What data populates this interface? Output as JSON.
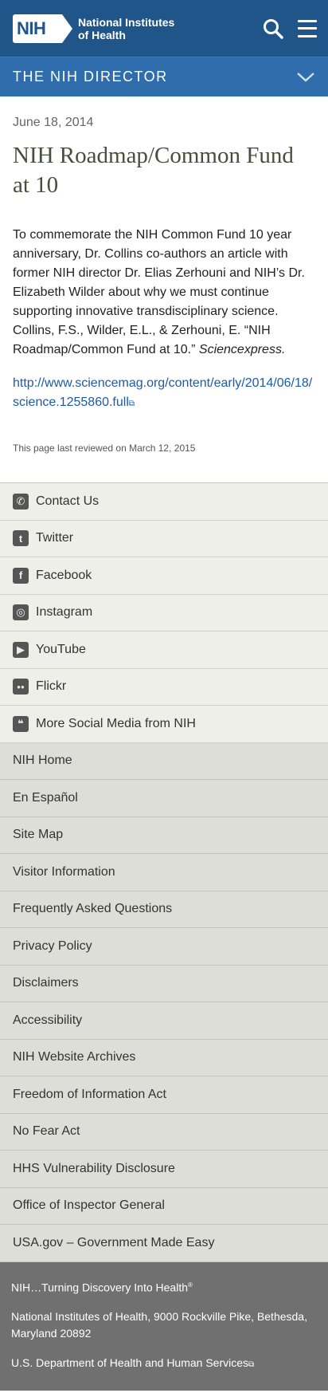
{
  "header": {
    "logo_badge": "NIH",
    "logo_line1": "National Institutes",
    "logo_line2": "of Health",
    "search_icon": "search-icon",
    "menu_icon": "hamburger-menu-icon"
  },
  "section": {
    "title": "THE NIH DIRECTOR",
    "toggle_icon": "chevron-down-icon"
  },
  "article": {
    "date": "June 18, 2014",
    "title": "NIH Roadmap/Common Fund at 10",
    "body_main": "To commemorate the NIH Common Fund 10 year anniversary, Dr. Collins co-authors an article with former NIH director Dr. Elias Zerhouni and NIH’s Dr. Elizabeth Wilder about why we must continue supporting innovative transdisciplinary science. Collins, F.S., Wilder, E.L., & Zerhouni, E. “NIH Roadmap/Common Fund at 10.”",
    "body_journal": "Sciencexpress.",
    "link_text": "http://www.sciencemag.org/content/early/2014/06/18/science.1255860.full",
    "link_icon": "⧉",
    "reviewed": "This page last reviewed on March 12, 2015"
  },
  "social": [
    {
      "label": "Contact Us",
      "icon": "phone-icon",
      "glyph": "✆"
    },
    {
      "label": "Twitter",
      "icon": "twitter-icon",
      "glyph": "t"
    },
    {
      "label": "Facebook",
      "icon": "facebook-icon",
      "glyph": "f"
    },
    {
      "label": "Instagram",
      "icon": "instagram-icon",
      "glyph": "◎"
    },
    {
      "label": "YouTube",
      "icon": "youtube-icon",
      "glyph": "▶"
    },
    {
      "label": "Flickr",
      "icon": "flickr-icon",
      "glyph": "●●"
    },
    {
      "label": "More Social Media from NIH",
      "icon": "speech-bubbles-icon",
      "glyph": "❝"
    }
  ],
  "footer_links": [
    "NIH Home",
    "En Español",
    "Site Map",
    "Visitor Information",
    "Frequently Asked Questions",
    "Privacy Policy",
    "Disclaimers",
    "Accessibility",
    "NIH Website Archives",
    "Freedom of Information Act",
    "No Fear Act",
    "HHS Vulnerability Disclosure",
    "Office of Inspector General",
    "USA.gov – Government Made Easy"
  ],
  "bottom": {
    "tagline": "NIH…Turning Discovery Into Health",
    "tagline_mark": "®",
    "address": "National Institutes of Health, 9000 Rockville Pike, Bethesda, Maryland 20892",
    "hhs": "U.S. Department of Health and Human Services",
    "hhs_icon": "⧉"
  },
  "colors": {
    "header_bg": "#20558a",
    "section_bg": "#2f6dad",
    "title_color": "#494d3c",
    "link_color": "#1e5aa8",
    "social_bg": "#efefe9",
    "footer_bg": "#deded8",
    "bottom_bg": "#707070"
  }
}
